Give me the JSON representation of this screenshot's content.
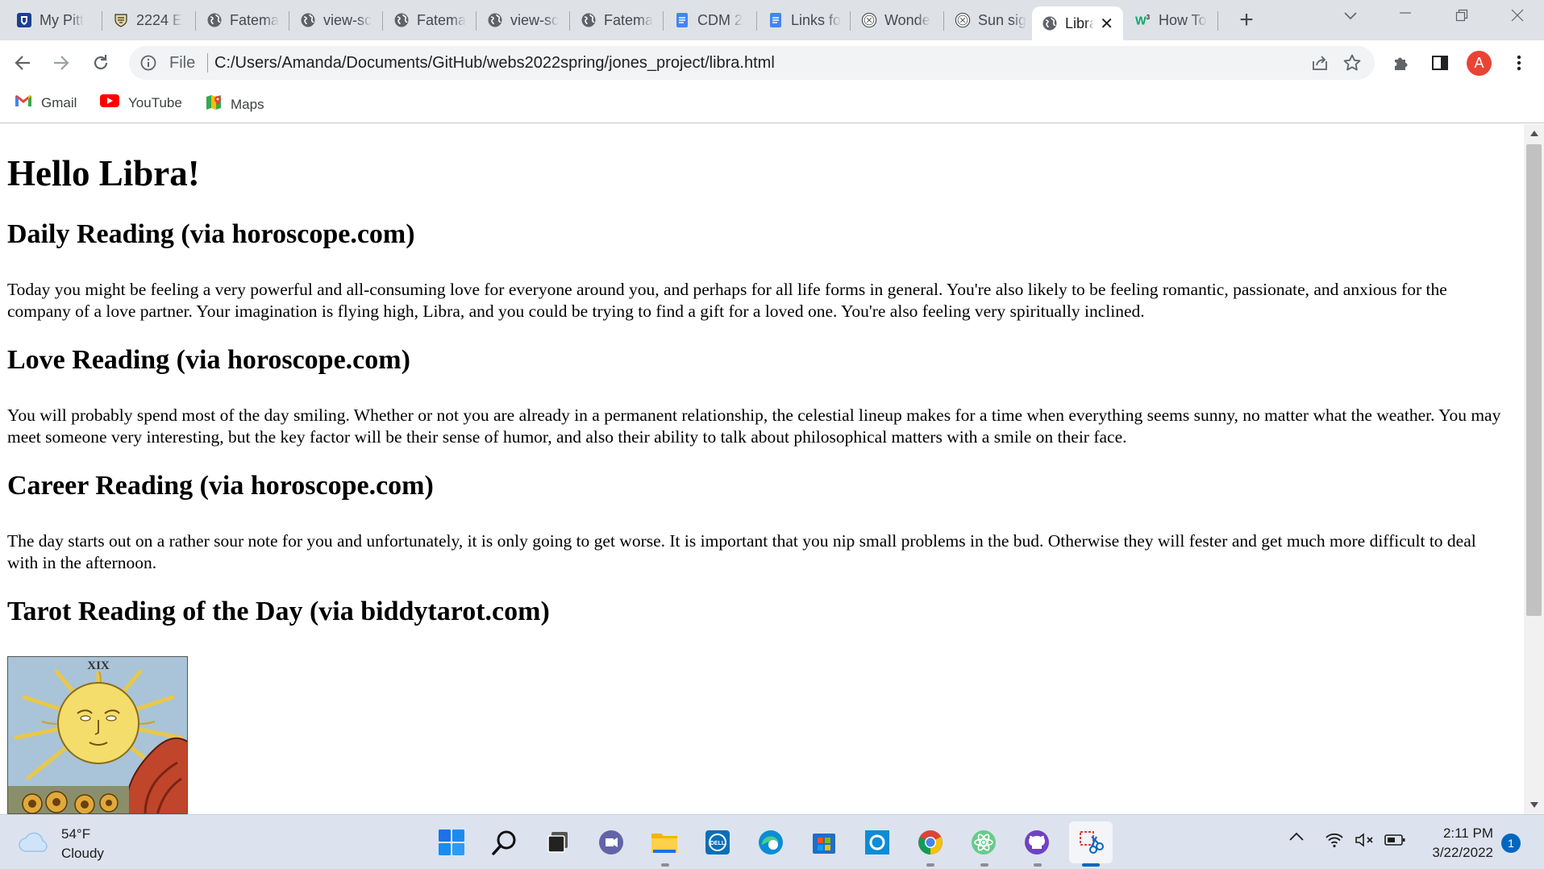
{
  "browser": {
    "tabs": [
      {
        "title": "My Pitt",
        "icon": "pitt-shield-icon"
      },
      {
        "title": "2224 E",
        "icon": "crest-icon"
      },
      {
        "title": "Fatema",
        "icon": "globe-icon"
      },
      {
        "title": "view-sc",
        "icon": "globe-icon"
      },
      {
        "title": "Fatema",
        "icon": "globe-icon"
      },
      {
        "title": "view-sc",
        "icon": "globe-icon"
      },
      {
        "title": "Fatema",
        "icon": "globe-icon"
      },
      {
        "title": "CDM 2",
        "icon": "docs-icon"
      },
      {
        "title": "Links fo",
        "icon": "docs-icon"
      },
      {
        "title": "Wonde",
        "icon": "zodiac-icon"
      },
      {
        "title": "Sun sig",
        "icon": "zodiac-icon"
      },
      {
        "title": "Libra",
        "icon": "globe-icon",
        "active": true
      },
      {
        "title": "How To",
        "icon": "w3schools-icon"
      }
    ],
    "new_tab": "+",
    "address": {
      "scheme_label": "File",
      "url": "C:/Users/Amanda/Documents/GitHub/webs2022spring/jones_project/libra.html"
    },
    "profile_initial": "A",
    "bookmarks": [
      {
        "label": "Gmail",
        "icon": "gmail-icon"
      },
      {
        "label": "YouTube",
        "icon": "youtube-icon"
      },
      {
        "label": "Maps",
        "icon": "maps-icon"
      }
    ]
  },
  "page": {
    "title": "Hello Libra!",
    "sections": [
      {
        "heading": "Daily Reading (via horoscope.com)",
        "text": "Today you might be feeling a very powerful and all-consuming love for everyone around you, and perhaps for all life forms in general. You're also likely to be feeling romantic, passionate, and anxious for the company of a love partner. Your imagination is flying high, Libra, and you could be trying to find a gift for a loved one. You're also feeling very spiritually inclined."
      },
      {
        "heading": "Love Reading (via horoscope.com)",
        "text": "You will probably spend most of the day smiling. Whether or not you are already in a permanent relationship, the celestial lineup makes for a time when everything seems sunny, no matter what the weather. You may meet someone very interesting, but the key factor will be their sense of humor, and also their ability to talk about philosophical matters with a smile on their face."
      },
      {
        "heading": "Career Reading (via horoscope.com)",
        "text": "The day starts out on a rather sour note for you and unfortunately, it is only going to get worse. It is important that you nip small problems in the bud. Otherwise they will fester and get much more difficult to deal with in the afternoon."
      },
      {
        "heading": "Tarot Reading of the Day (via biddytarot.com)",
        "text": ""
      }
    ],
    "tarot_card": {
      "numeral": "XIX",
      "image": "sun-tarot-card"
    }
  },
  "taskbar": {
    "weather": {
      "temp": "54°F",
      "condition": "Cloudy"
    },
    "apps": [
      "start",
      "search",
      "task-view",
      "teams-chat",
      "file-explorer",
      "dell",
      "edge",
      "store",
      "cortana",
      "chrome",
      "atom",
      "github-desktop",
      "snipping-tool"
    ],
    "clock": {
      "time": "2:11 PM",
      "date": "3/22/2022"
    },
    "notifications": "1"
  },
  "colors": {
    "tab_strip": "#dee1e6",
    "taskbar": "#dce3ee",
    "accent": "#0067c0",
    "profile": "#ea4335"
  }
}
